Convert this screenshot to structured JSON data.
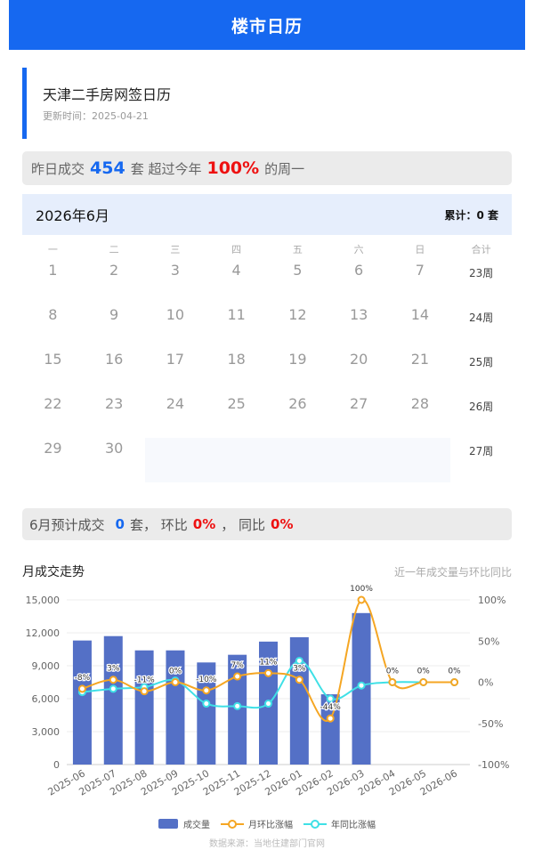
{
  "header": {
    "title": "楼市日历"
  },
  "info": {
    "title": "天津二手房网签日历",
    "update_label": "更新时间：",
    "update_date": "2025-04-21"
  },
  "summary": {
    "prefix": "昨日成交",
    "count": "454",
    "unit_text": "套  超过今年",
    "percent": "100%",
    "suffix": "的周一"
  },
  "calendar": {
    "month_title": "2026年6月",
    "total_label": "累计：0 套",
    "weekday_headers": [
      "一",
      "二",
      "三",
      "四",
      "五",
      "六",
      "日",
      "合计"
    ],
    "weeks": [
      {
        "days": [
          "1",
          "2",
          "3",
          "4",
          "5",
          "6",
          "7"
        ],
        "week": "23周"
      },
      {
        "days": [
          "8",
          "9",
          "10",
          "11",
          "12",
          "13",
          "14"
        ],
        "week": "24周"
      },
      {
        "days": [
          "15",
          "16",
          "17",
          "18",
          "19",
          "20",
          "21"
        ],
        "week": "25周"
      },
      {
        "days": [
          "22",
          "23",
          "24",
          "25",
          "26",
          "27",
          "28"
        ],
        "week": "26周"
      },
      {
        "days": [
          "29",
          "30",
          "",
          "",
          "",
          "",
          ""
        ],
        "week": "27周"
      }
    ]
  },
  "forecast": {
    "prefix": "6月预计成交",
    "count": "0",
    "mid1": "套，  环比",
    "mom": "0%",
    "mid2": "，  同比",
    "yoy": "0%"
  },
  "trend": {
    "title": "月成交走势",
    "note": "近一年成交量与环比同比"
  },
  "legend": {
    "bar_label": "成交量",
    "mom_label": "月环比涨幅",
    "yoy_label": "年同比涨幅"
  },
  "source": "数据来源：当地住建部门官网",
  "colors": {
    "bar": "#5470c6",
    "mom": "#f5a623",
    "yoy": "#3fe0e6",
    "accent": "#1668f0",
    "highlight": "#ee1111"
  },
  "chart_data": {
    "type": "bar",
    "categories": [
      "2025-06",
      "2025-07",
      "2025-08",
      "2025-09",
      "2025-10",
      "2025-11",
      "2025-12",
      "2026-01",
      "2026-02",
      "2026-03",
      "2026-04",
      "2026-05",
      "2026-06"
    ],
    "series": [
      {
        "name": "成交量",
        "type": "bar",
        "axis": "left",
        "values": [
          11300,
          11700,
          10400,
          10400,
          9300,
          10000,
          11200,
          11600,
          6400,
          13800,
          0,
          0,
          0
        ]
      },
      {
        "name": "月环比涨幅",
        "type": "line",
        "axis": "right",
        "values": [
          -8,
          3,
          -11,
          0,
          -10,
          7,
          11,
          3,
          -44,
          100,
          0,
          0,
          0
        ],
        "labels": [
          "-8%",
          "3%",
          "-11%",
          "0%",
          "-10%",
          "7%",
          "11%",
          "3%",
          "-44%",
          "100%",
          "0%",
          "0%",
          "0%"
        ]
      },
      {
        "name": "年同比涨幅",
        "type": "line",
        "axis": "right",
        "values": [
          -12,
          -8,
          -6,
          2,
          -26,
          -29,
          -26,
          26,
          -20,
          -4,
          0,
          0,
          0
        ]
      }
    ],
    "y_left": {
      "min": 0,
      "max": 15000,
      "ticks": [
        "0",
        "3,000",
        "6,000",
        "9,000",
        "12,000",
        "15,000"
      ]
    },
    "y_right": {
      "min": -100,
      "max": 100,
      "ticks": [
        "-100%",
        "-50%",
        "0%",
        "50%",
        "100%"
      ]
    },
    "grid": true,
    "legend_position": "bottom"
  }
}
